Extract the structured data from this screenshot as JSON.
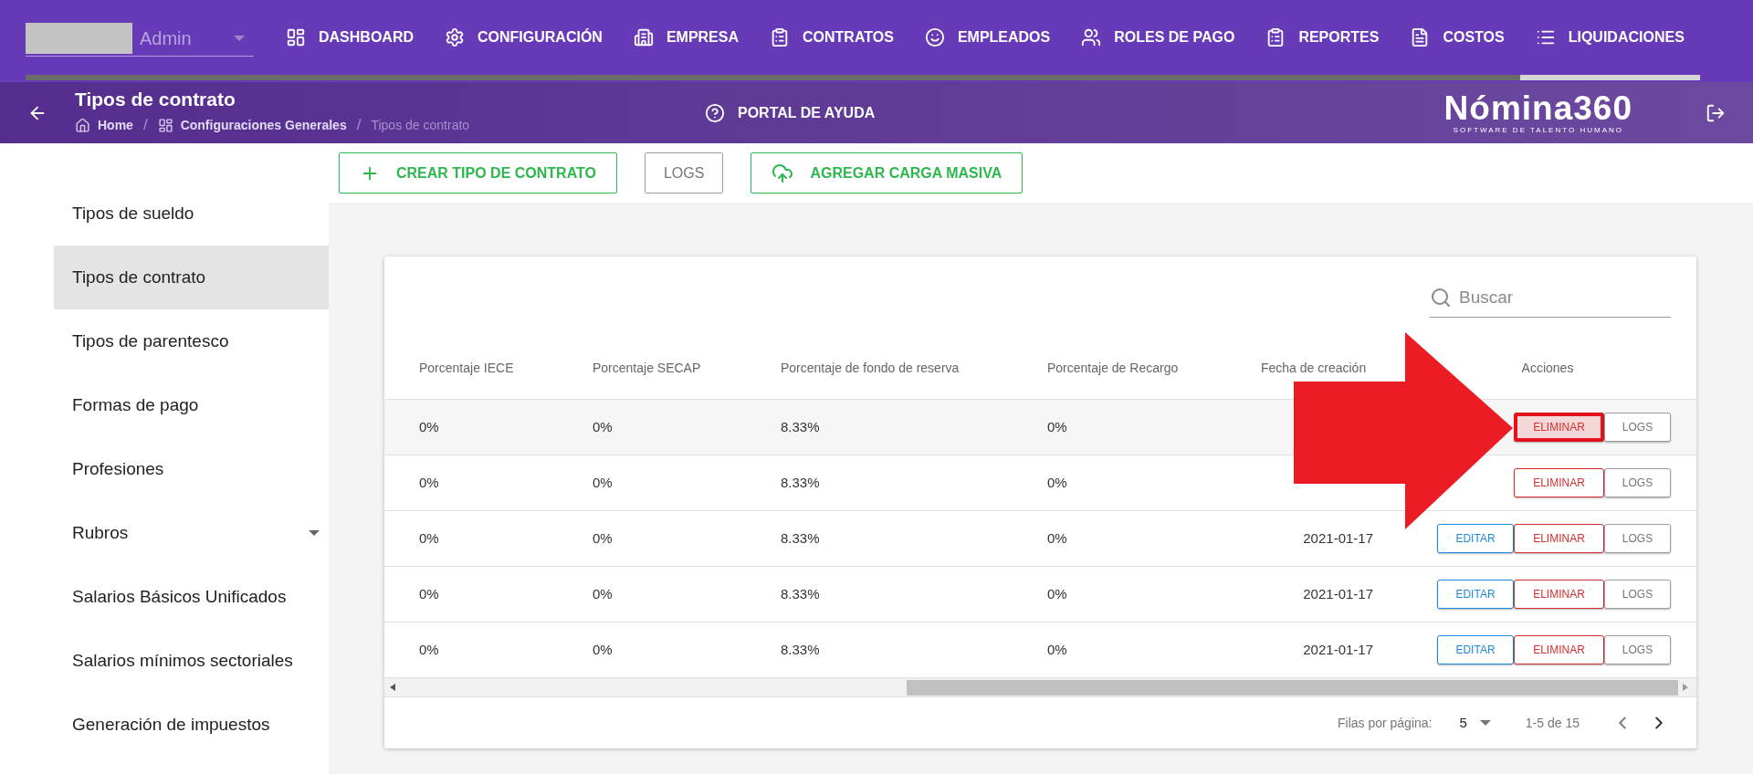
{
  "account": {
    "label": "Admin"
  },
  "nav": [
    {
      "label": "DASHBOARD",
      "selected": false
    },
    {
      "label": "CONFIGURACIÓN",
      "selected": false
    },
    {
      "label": "EMPRESA",
      "selected": false
    },
    {
      "label": "CONTRATOS",
      "selected": false
    },
    {
      "label": "EMPLEADOS",
      "selected": false
    },
    {
      "label": "ROLES DE PAGO",
      "selected": false
    },
    {
      "label": "REPORTES",
      "selected": false
    },
    {
      "label": "COSTOS",
      "selected": false
    },
    {
      "label": "LIQUIDACIONES",
      "selected": true
    }
  ],
  "header": {
    "title": "Tipos de contrato",
    "breadcrumb": [
      {
        "label": "Home"
      },
      {
        "separator": "/",
        "label": "Configuraciones Generales"
      },
      {
        "separator": "/",
        "label": "Tipos de contrato"
      }
    ],
    "help": "PORTAL DE AYUDA",
    "logo": "Nómina360",
    "logo_tagline": "SOFTWARE DE TALENTO HUMANO"
  },
  "sidebar": {
    "items": [
      {
        "label": "Tipos de sueldo",
        "selected": false
      },
      {
        "label": "Tipos de contrato",
        "selected": true
      },
      {
        "label": "Tipos de parentesco",
        "selected": false
      },
      {
        "label": "Formas de pago",
        "selected": false
      },
      {
        "label": "Profesiones",
        "selected": false
      },
      {
        "label": "Rubros",
        "selected": false,
        "expandable": true
      },
      {
        "label": "Salarios Básicos Unificados",
        "selected": false
      },
      {
        "label": "Salarios mínimos sectoriales",
        "selected": false
      },
      {
        "label": "Generación de impuestos",
        "selected": false
      }
    ]
  },
  "toolbar": [
    {
      "kind": "add",
      "label": "CREAR TIPO DE CONTRATO"
    },
    {
      "kind": "plain",
      "label": "LOGS"
    },
    {
      "kind": "upload",
      "label": "AGREGAR CARGA MASIVA"
    }
  ],
  "table": {
    "search": {
      "placeholder": "Buscar"
    },
    "columns": [
      "Porcentaje IECE",
      "Porcentaje SECAP",
      "Porcentaje de fondo de reserva",
      "Porcentaje de Recargo",
      "Fecha de creación",
      "Acciones"
    ],
    "rows": [
      {
        "cells": [
          "0%",
          "0%",
          "8.33%",
          "0%"
        ],
        "selected": true,
        "actions": [
          "ELIMINAR",
          "LOGS"
        ]
      },
      {
        "cells": [
          "0%",
          "0%",
          "8.33%",
          "0%"
        ],
        "selected": false,
        "actions": [
          "ELIMINAR",
          "LOGS"
        ]
      },
      {
        "cells": [
          "0%",
          "0%",
          "8.33%",
          "0%",
          "2021-01-17"
        ],
        "selected": false,
        "actions": [
          "EDITAR",
          "ELIMINAR",
          "LOGS"
        ]
      },
      {
        "cells": [
          "0%",
          "0%",
          "8.33%",
          "0%",
          "2021-01-17"
        ],
        "selected": false,
        "actions": [
          "EDITAR",
          "ELIMINAR",
          "LOGS"
        ]
      },
      {
        "cells": [
          "0%",
          "0%",
          "8.33%",
          "0%",
          "2021-01-17"
        ],
        "selected": false,
        "actions": [
          "EDITAR",
          "ELIMINAR",
          "LOGS"
        ]
      }
    ],
    "pagination": {
      "rows_label": "Filas por página:",
      "rows_value": "5",
      "range": "1-5 de 15"
    }
  },
  "annotation": {
    "kind": "arrow"
  }
}
